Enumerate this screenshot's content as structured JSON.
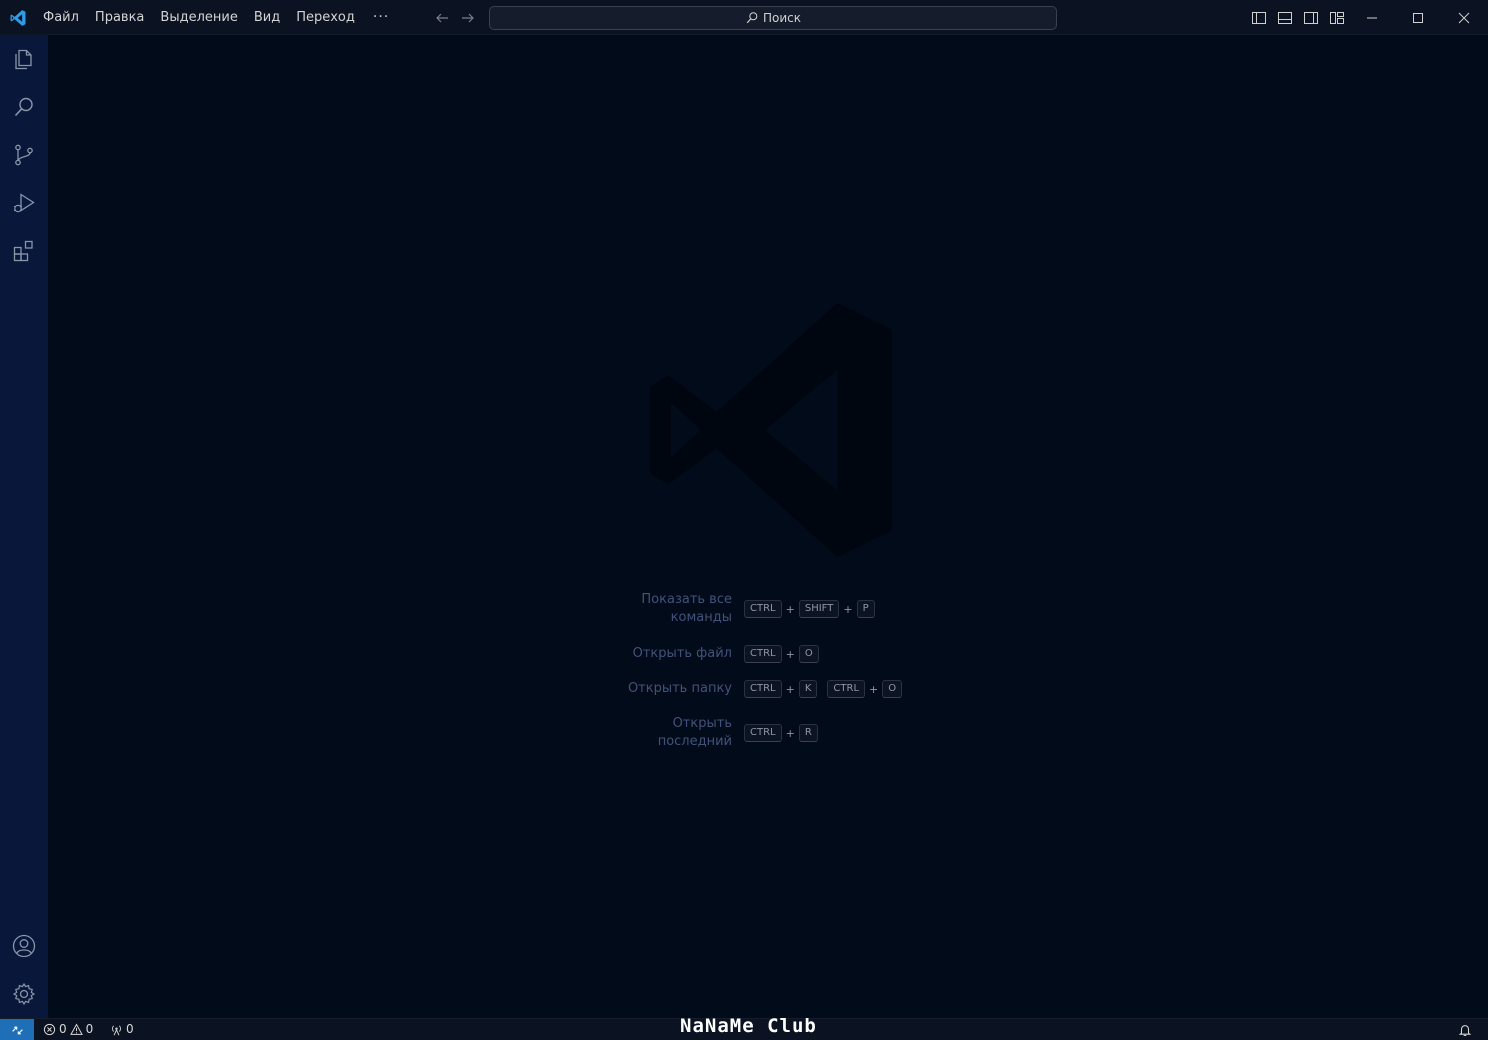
{
  "titlebar": {
    "logo_icon": "vscode-logo-icon",
    "menu": [
      "Файл",
      "Правка",
      "Выделение",
      "Вид",
      "Переход"
    ],
    "more_label": "···",
    "search": {
      "label": "Поиск",
      "icon": "search-icon"
    },
    "layout_icons": [
      "toggle-primary-sidebar-icon",
      "toggle-panel-icon",
      "toggle-secondary-sidebar-icon",
      "customize-layout-icon"
    ],
    "window_controls": [
      "minimize-icon",
      "maximize-icon",
      "close-icon"
    ]
  },
  "activitybar": {
    "top": [
      "explorer-icon",
      "search-icon",
      "source-control-icon",
      "run-debug-icon",
      "extensions-icon"
    ],
    "bottom": [
      "accounts-icon",
      "manage-gear-icon"
    ],
    "color": "#08173a"
  },
  "welcome": {
    "watermark_icon": "vscode-logo-watermark-icon",
    "shortcuts": [
      {
        "label": "Показать все команды",
        "keys": [
          [
            "CTRL",
            "SHIFT",
            "P"
          ]
        ]
      },
      {
        "label": "Открыть файл",
        "keys": [
          [
            "CTRL",
            "O"
          ]
        ]
      },
      {
        "label": "Открыть папку",
        "keys": [
          [
            "CTRL",
            "K"
          ],
          [
            "CTRL",
            "O"
          ]
        ]
      },
      {
        "label": "Открыть последний",
        "keys": [
          [
            "CTRL",
            "R"
          ]
        ]
      }
    ],
    "plus": "+"
  },
  "statusbar": {
    "remote_icon": "remote-indicator-icon",
    "errors": "0",
    "warnings": "0",
    "ports": "0",
    "brand": "NaNaMe Club",
    "bell_icon": "notifications-bell-icon",
    "accent": "#1f6fb8"
  }
}
